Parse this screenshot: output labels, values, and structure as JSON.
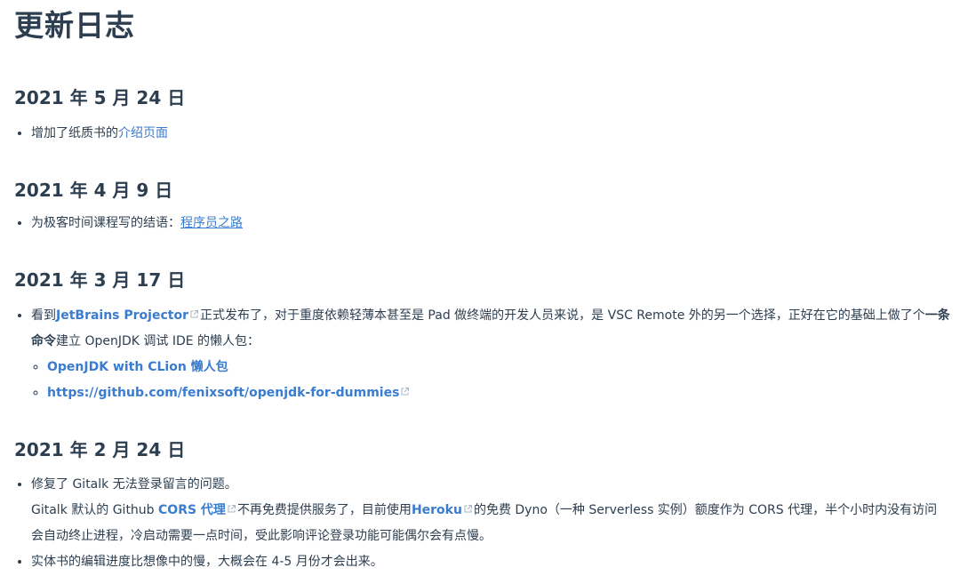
{
  "page_title": "更新日志",
  "sections": [
    {
      "date": "2021 年 5 月 24 日",
      "items": [
        {
          "text": "增加了纸质书的",
          "link": "介绍页面"
        }
      ]
    },
    {
      "date": "2021 年 4 月 9 日",
      "items": [
        {
          "text": "为极客时间课程写的结语：",
          "link": "程序员之路"
        }
      ]
    },
    {
      "date": "2021 年 3 月 17 日",
      "items": [
        {
          "prefix": "看到",
          "link": "JetBrains Projector",
          "text_a": "正式发布了，对于重度依赖轻薄本甚至是 Pad 做终端的开发人员来说，是 VSC Remote 外的另一个选择，正好在它的基础上做了个",
          "bold": "一条命令",
          "text_b": "建立 OpenJDK 调试 IDE 的懒人包：",
          "sub": [
            {
              "link": "OpenJDK with CLion 懒人包"
            },
            {
              "link": "https://github.com/fenixsoft/openjdk-for-dummies"
            }
          ]
        }
      ]
    },
    {
      "date": "2021 年 2 月 24 日",
      "items": [
        {
          "text": "修复了 Gitalk 无法登录留言的问题。",
          "line2_a": "Gitalk 默认的 Github ",
          "link1": "CORS 代理",
          "line2_b": "不再免费提供服务了，目前使用",
          "link2": "Heroku",
          "line2_c": "的免费 Dyno（一种 Serverless 实例）额度作为 CORS 代理，半个小时内没有访问会自动终止进程，冷启动需要一点时间，受此影响评论登录功能可能偶尔会有点慢。"
        },
        {
          "text": "实体书的编辑进度比想像中的慢，大概会在 4-5 月份才会出来。"
        }
      ]
    }
  ],
  "colors": {
    "link": "#3a7ccf",
    "text": "#2c3e50",
    "icon": "#aab4c0"
  },
  "icons": {
    "external": "external-link-icon"
  }
}
